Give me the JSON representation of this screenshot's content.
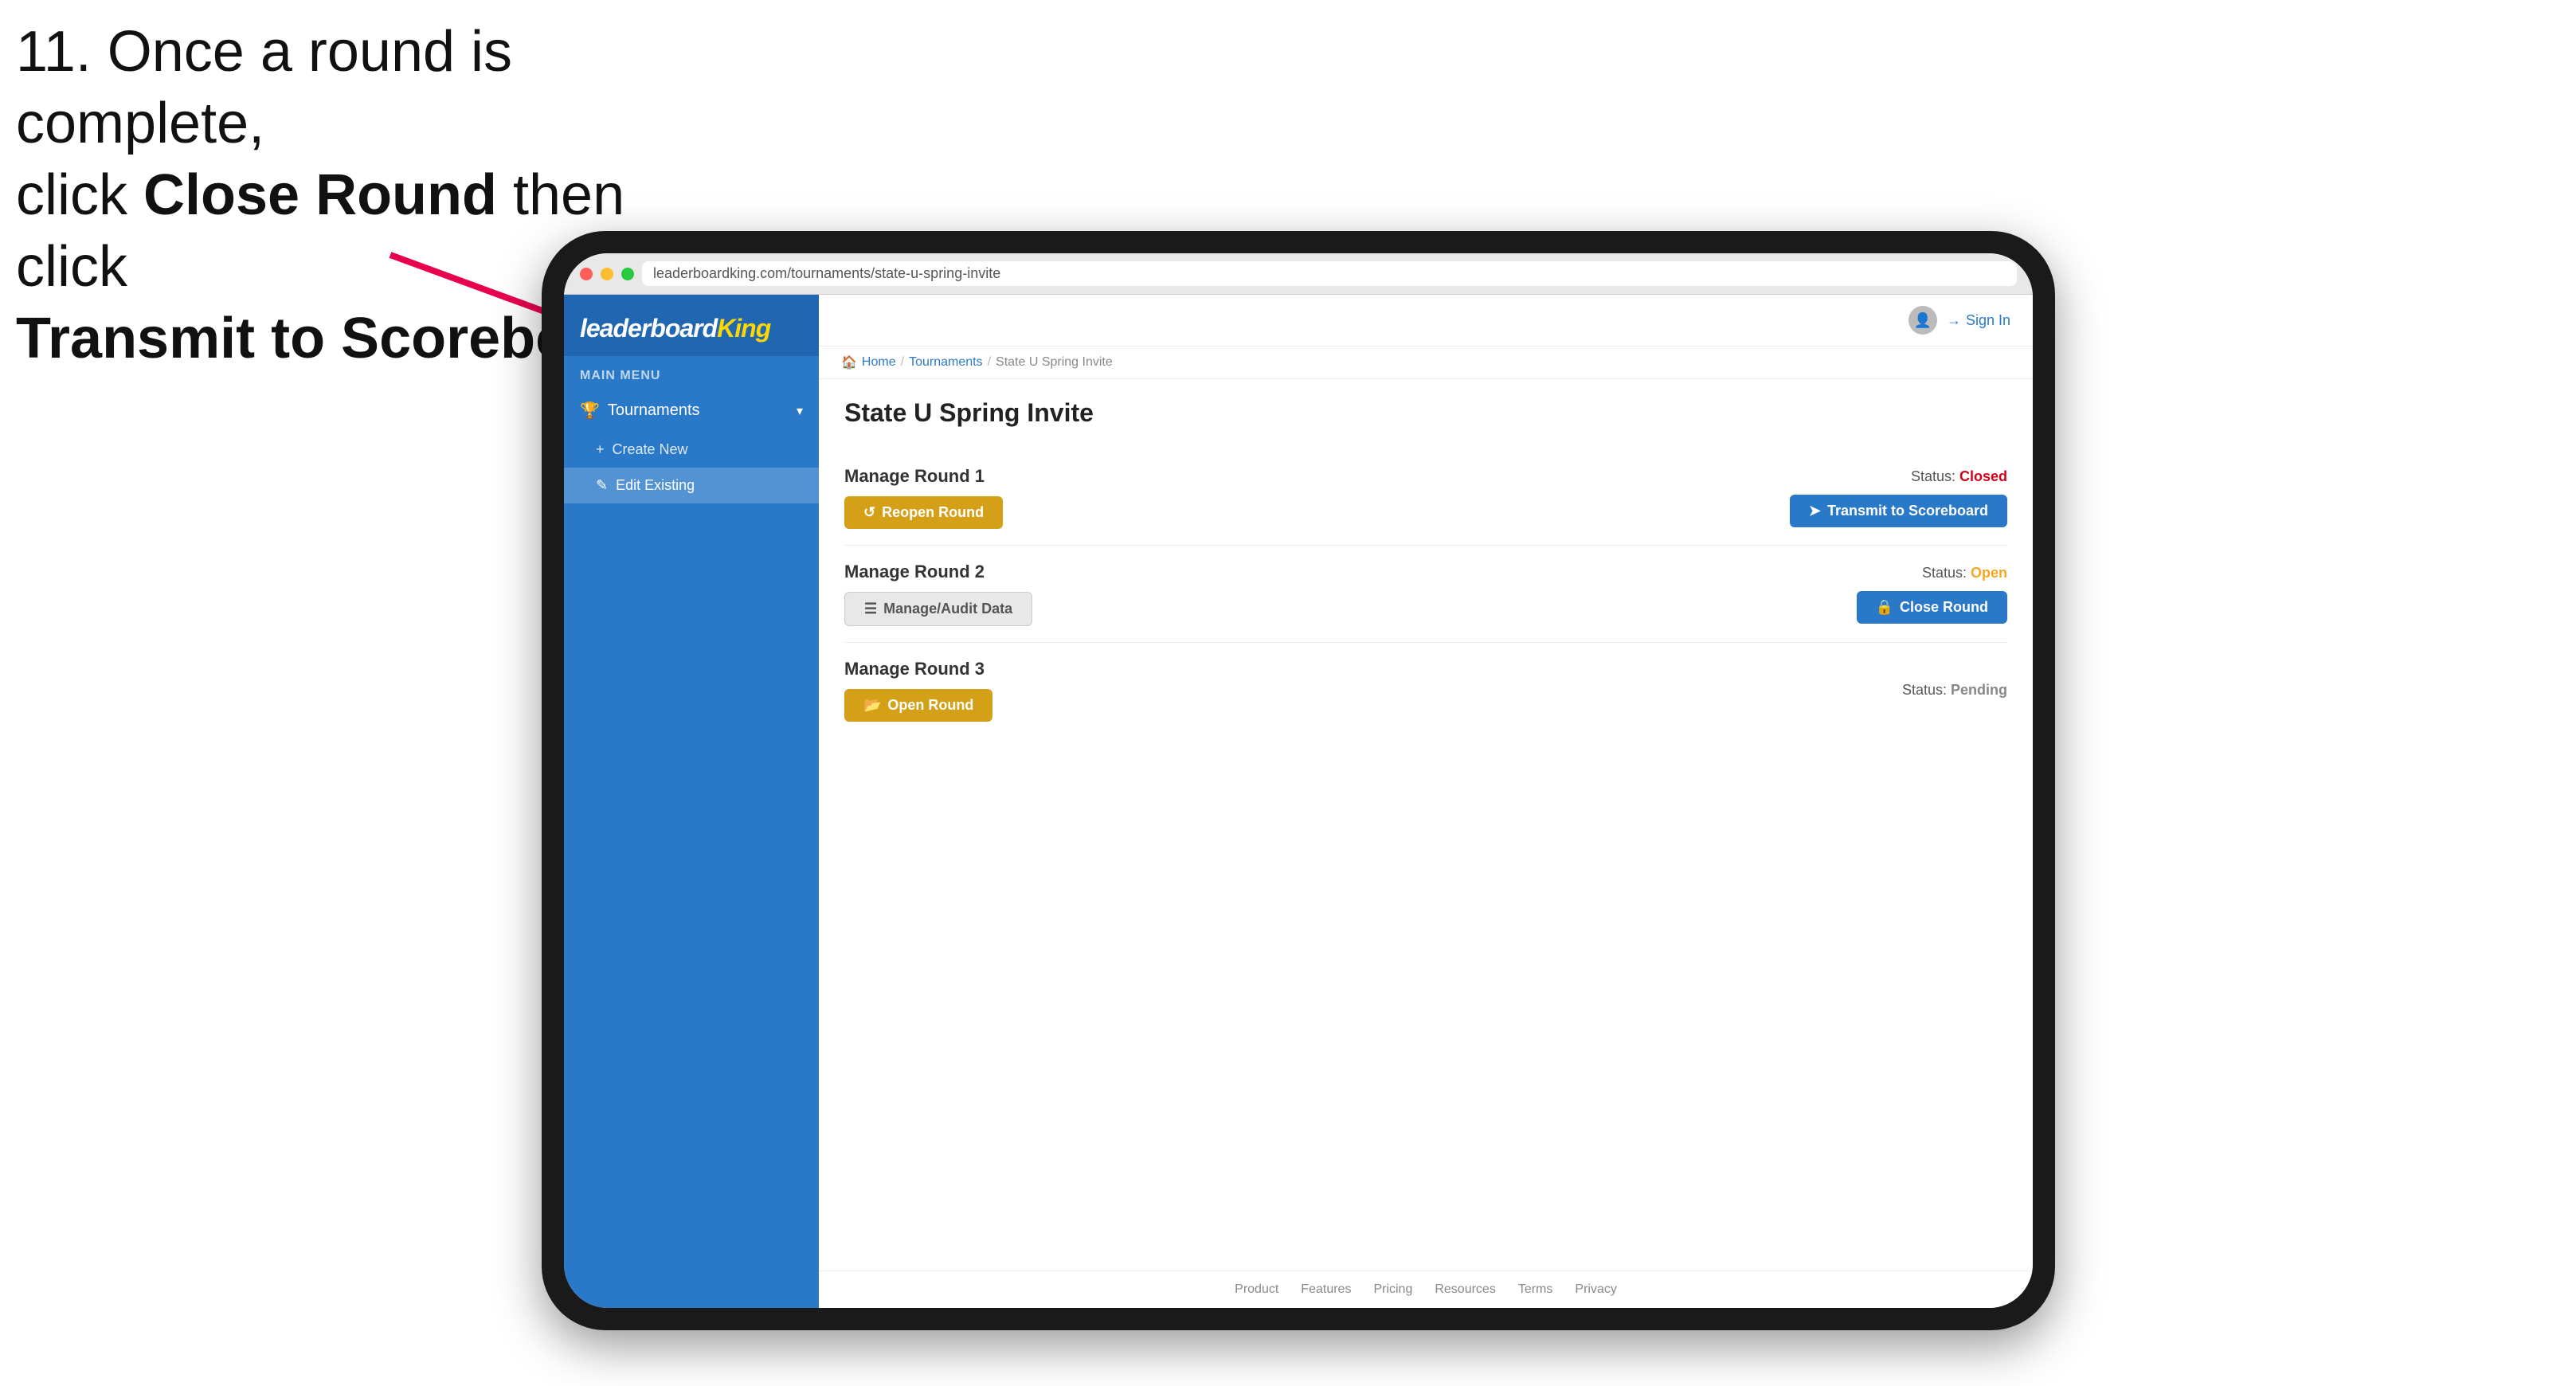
{
  "instruction": {
    "line1": "11. Once a round is complete,",
    "line2_prefix": "click ",
    "line2_bold": "Close Round",
    "line2_suffix": " then click",
    "line3_bold": "Transmit to Scoreboard."
  },
  "tablet": {
    "browser": {
      "url": "leaderboardking.com/tournaments/state-u-spring-invite"
    },
    "sidebar": {
      "logo": {
        "prefix": "leaderboard",
        "suffix": "King"
      },
      "main_menu_label": "MAIN MENU",
      "nav_items": [
        {
          "label": "Tournaments",
          "icon": "trophy-icon",
          "expanded": true,
          "sub_items": [
            {
              "label": "Create New",
              "icon": "plus-icon",
              "active": false
            },
            {
              "label": "Edit Existing",
              "icon": "edit-icon",
              "active": true
            }
          ]
        }
      ]
    },
    "header": {
      "sign_in_label": "Sign In"
    },
    "breadcrumb": {
      "home": "Home",
      "tournaments": "Tournaments",
      "current": "State U Spring Invite"
    },
    "page_title": "State U Spring Invite",
    "rounds": [
      {
        "id": "round1",
        "title": "Manage Round 1",
        "status_label": "Status:",
        "status_value": "Closed",
        "status_type": "closed",
        "buttons": [
          {
            "label": "Reopen Round",
            "type": "gold",
            "icon": "reopen-icon"
          },
          {
            "label": "Transmit to Scoreboard",
            "type": "blue",
            "icon": "transmit-icon"
          }
        ]
      },
      {
        "id": "round2",
        "title": "Manage Round 2",
        "status_label": "Status:",
        "status_value": "Open",
        "status_type": "open",
        "buttons": [
          {
            "label": "Manage/Audit Data",
            "type": "gray",
            "icon": "manage-icon"
          },
          {
            "label": "Close Round",
            "type": "blue",
            "icon": "close-icon"
          }
        ]
      },
      {
        "id": "round3",
        "title": "Manage Round 3",
        "status_label": "Status:",
        "status_value": "Pending",
        "status_type": "pending",
        "buttons": [
          {
            "label": "Open Round",
            "type": "gold",
            "icon": "open-icon"
          }
        ]
      }
    ],
    "footer": {
      "links": [
        "Product",
        "Features",
        "Pricing",
        "Resources",
        "Terms",
        "Privacy"
      ]
    }
  }
}
